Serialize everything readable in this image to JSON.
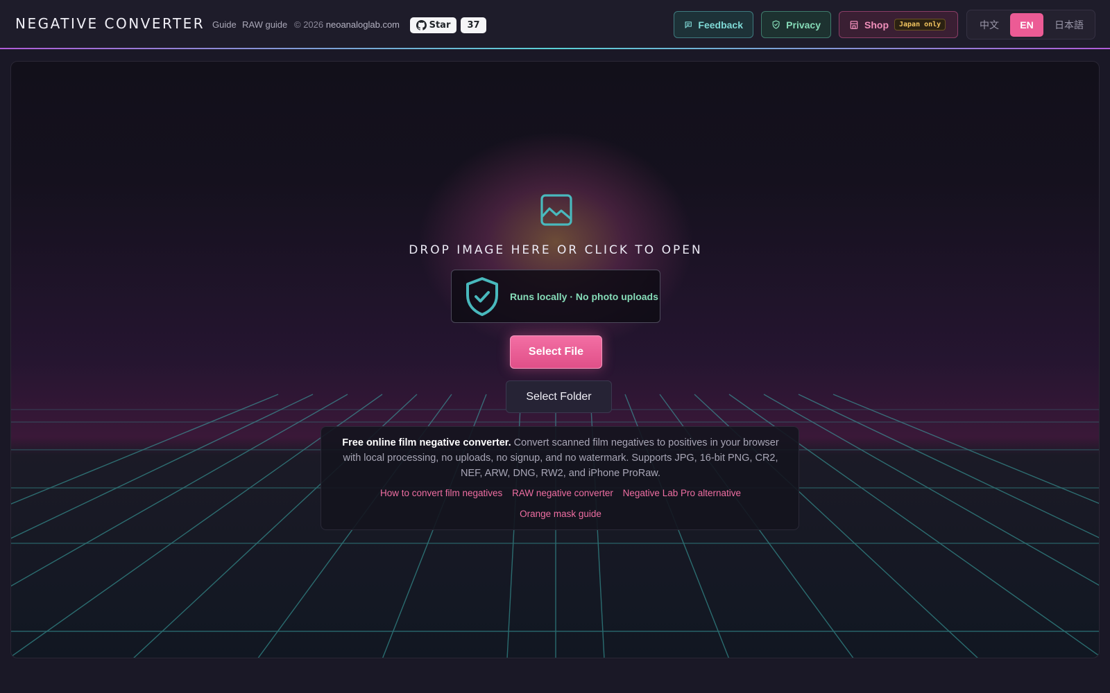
{
  "header": {
    "brand": "NEGATIVE CONVERTER",
    "nav": [
      {
        "label": "Guide"
      },
      {
        "label": "RAW guide"
      }
    ],
    "copyright_prefix": "© 2026",
    "copyright_domain": "neoanaloglab.com",
    "github": {
      "star_label": "Star",
      "count": "37"
    },
    "buttons": {
      "feedback": "Feedback",
      "privacy": "Privacy",
      "shop": "Shop",
      "shop_badge": "Japan only"
    },
    "languages": [
      {
        "label": "中文",
        "active": false
      },
      {
        "label": "EN",
        "active": true
      },
      {
        "label": "日本語",
        "active": false
      }
    ]
  },
  "dropzone": {
    "title": "DROP IMAGE HERE OR CLICK TO OPEN",
    "local_notice": "Runs locally · No photo uploads",
    "select_file": "Select File",
    "select_folder": "Select Folder"
  },
  "info": {
    "headline": "Free online film negative converter.",
    "body": " Convert scanned film negatives to positives in your browser with local processing, no uploads, no signup, and no watermark. Supports JPG, 16-bit PNG, CR2, NEF, ARW, DNG, RW2, and iPhone ProRaw.",
    "links": [
      "How to convert film negatives",
      "RAW negative converter",
      "Negative Lab Pro alternative",
      "Orange mask guide"
    ]
  },
  "colors": {
    "accent_pink": "#ec5b95",
    "accent_teal": "#5ad1d6",
    "accent_green": "#86dcb8"
  }
}
